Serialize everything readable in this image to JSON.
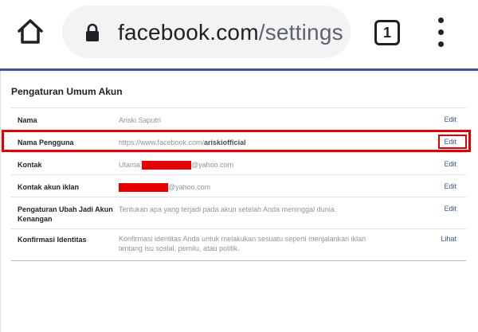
{
  "browser": {
    "url_domain": "facebook.com",
    "url_path": "/settings",
    "tab_count": "1",
    "icons": [
      "home-icon",
      "lock-icon",
      "tab-switcher-icon",
      "overflow-menu-icon"
    ]
  },
  "settings": {
    "title": "Pengaturan Umum Akun",
    "rows": [
      {
        "label": "Nama",
        "value": "Ariski Saputri",
        "action": "Edit"
      },
      {
        "label": "Nama Pengguna",
        "value_prefix": "https://www.facebook.com/",
        "value_bold": "ariskiofficial",
        "action": "Edit"
      },
      {
        "label": "Kontak",
        "value_prefix": "Utama:",
        "value_suffix": "@yahoo.com",
        "action": "Edit"
      },
      {
        "label": "Kontak akun iklan",
        "value_suffix": "@yahoo.com",
        "action": "Edit"
      },
      {
        "label": "Pengaturan Ubah Jadi Akun Kenangan",
        "value": "Tentukan apa yang terjadi pada akun setelah Anda meninggal dunia.",
        "action": "Edit"
      },
      {
        "label": "Konfirmasi Identitas",
        "value": "Konfirmasi identitas Anda untuk melakukan sesuatu seperti menjalankan iklan tentang isu sosial, pemilu, atau politik.",
        "action": "Lihat"
      }
    ]
  },
  "colors": {
    "link": "#365899",
    "highlight": "#e00000",
    "redaction": "#e60000",
    "header_rule": "#3b5998"
  }
}
